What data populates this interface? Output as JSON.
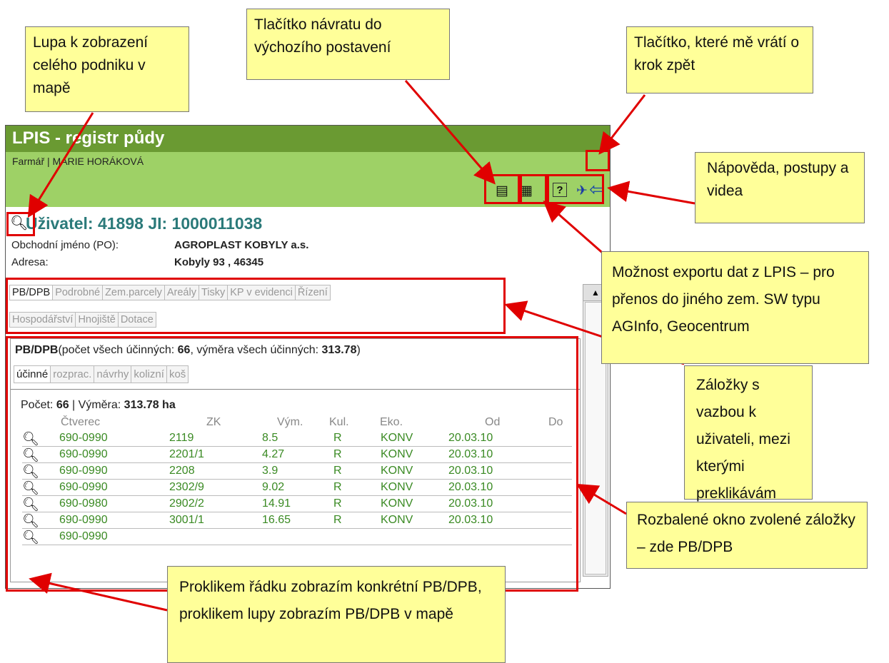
{
  "window": {
    "title": "LPIS - registr půdy",
    "subtitle": "Farmář | MARIE HORÁKOVÁ",
    "user_heading": "Uživatel: 41898 JI: 1000011038",
    "company_label": "Obchodní jméno (PO):",
    "company_value": "AGROPLAST KOBYLY a.s.",
    "address_label": "Adresa:",
    "address_value": "Kobyly 93 , 46345",
    "tabs_row1": [
      "PB/DPB",
      "Podrobné",
      "Zem.parcely",
      "Areály",
      "Tisky",
      "KP v evidenci",
      "Řízení"
    ],
    "tabs_row2": [
      "Hospodářství",
      "Hnojiště",
      "Dotace"
    ],
    "section": {
      "title": "PB/DPB",
      "summary_pre": "(počet všech účinných: ",
      "summary_count": "66",
      "summary_mid": ", výměra všech účinných: ",
      "summary_area": "313.78",
      "summary_post": ")",
      "subtabs": [
        "účinné",
        "rozprac.",
        "návrhy",
        "kolizní",
        "koš"
      ],
      "count_label": "Počet: ",
      "count_value": "66",
      "area_label": " | Výměra: ",
      "area_value": "313.78 ha"
    },
    "table": {
      "columns": [
        "Čtverec",
        "ZK",
        "Vým.",
        "Kul.",
        "Eko.",
        "Od",
        "Do"
      ],
      "rows": [
        [
          "690-0990",
          "2119",
          "8.5",
          "R",
          "KONV",
          "20.03.10",
          ""
        ],
        [
          "690-0990",
          "2201/1",
          "4.27",
          "R",
          "KONV",
          "20.03.10",
          ""
        ],
        [
          "690-0990",
          "2208",
          "3.9",
          "R",
          "KONV",
          "20.03.10",
          ""
        ],
        [
          "690-0990",
          "2302/9",
          "9.02",
          "R",
          "KONV",
          "20.03.10",
          ""
        ],
        [
          "690-0980",
          "2902/2",
          "14.91",
          "R",
          "KONV",
          "20.03.10",
          ""
        ],
        [
          "690-0990",
          "3001/1",
          "16.65",
          "R",
          "KONV",
          "20.03.10",
          ""
        ],
        [
          "690-0990",
          "",
          "",
          "",
          "",
          "",
          ""
        ]
      ]
    },
    "icons": [
      "magnifier-icon",
      "back-arrow-icon",
      "clipboard-icon",
      "export-icon",
      "help-icon",
      "video-icon"
    ]
  },
  "annotations": {
    "lupa": "Lupa k zobrazení celého podniku v mapě",
    "home": "Tlačítko návratu do výchozího postavení",
    "back": "Tlačítko, které mě vrátí o krok zpět",
    "help": "Nápověda, postupy a videa",
    "export": "Možnost exportu dat z LPIS – pro přenos do jiného zem. SW typu AGInfo, Geocentrum",
    "tabs": "Záložky s vazbou k uživateli, mezi kterými preklikávám",
    "window": "Rozbalené okno zvolené záložky – zde PB/DPB",
    "row": "Proklikem řádku zobrazím konkrétní PB/DPB, proklikem lupy zobrazím PB/DPB v mapě"
  },
  "colors": {
    "header_dark": "#6a9a32",
    "header_light": "#9ed166",
    "note_bg": "#ffff99",
    "highlight": "#e00000",
    "link_green": "#3a8a23"
  }
}
